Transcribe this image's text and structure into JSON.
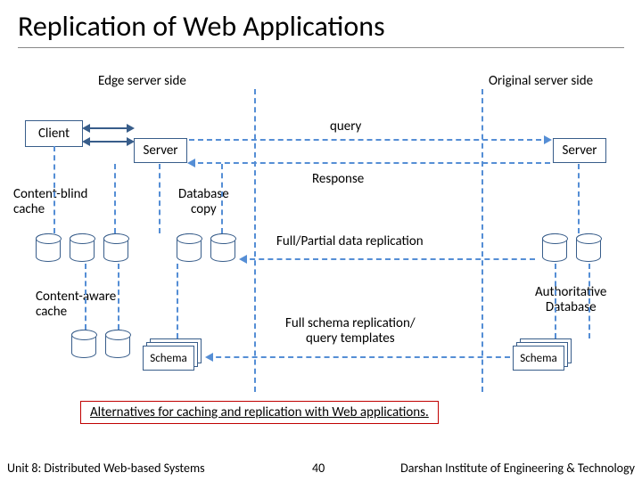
{
  "title": "Replication of Web Applications",
  "sections": {
    "edge": "Edge server side",
    "original": "Original server side"
  },
  "nodes": {
    "client": "Client",
    "server_left": "Server",
    "server_right": "Server",
    "db_copy": "Database\ncopy",
    "content_blind": "Content-blind\ncache",
    "content_aware": "Content-aware\ncache",
    "schema_left": "Schema",
    "schema_right": "Schema",
    "auth_db": "Authoritative\nDatabase"
  },
  "flows": {
    "query": "query",
    "response": "Response",
    "full_partial": "Full/Partial data replication",
    "full_schema": "Full schema replication/\nquery templates"
  },
  "caption": "Alternatives for caching and replication with Web applications.",
  "footer": {
    "left": "Unit 8: Distributed Web-based Systems",
    "page": "40",
    "right": "Darshan Institute of Engineering & Technology"
  }
}
